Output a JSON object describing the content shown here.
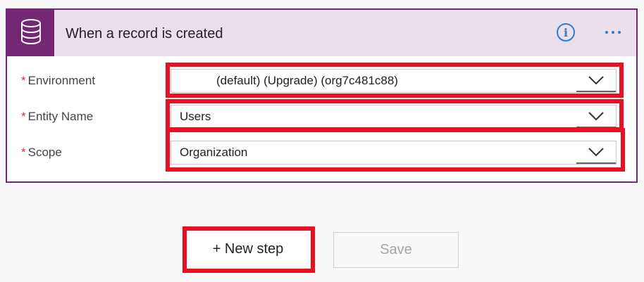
{
  "card": {
    "title": "When a record is created",
    "icon": "database-icon",
    "accent_color": "#742774",
    "header_bg": "#ecdfec",
    "info_icon": "info-icon",
    "more_icon": "ellipsis-icon"
  },
  "fields": [
    {
      "label": "Environment",
      "required_mark": "*",
      "value": "(default) (Upgrade) (org7c481c88)"
    },
    {
      "label": "Entity Name",
      "required_mark": "*",
      "value": "Users"
    },
    {
      "label": "Scope",
      "required_mark": "*",
      "value": "Organization"
    }
  ],
  "actions": {
    "new_step_label": "+ New step",
    "save_label": "Save"
  },
  "colors": {
    "highlight": "#e81123",
    "link_blue": "#2b7cd3",
    "required": "#d13438"
  }
}
